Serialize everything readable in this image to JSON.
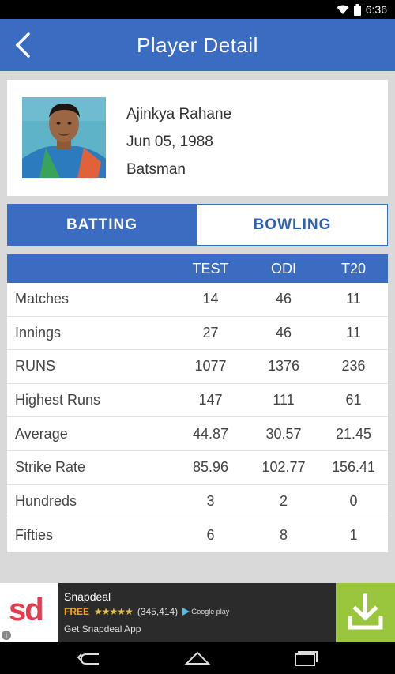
{
  "status_bar": {
    "time": "6:36"
  },
  "header": {
    "title": "Player Detail"
  },
  "player": {
    "name": "Ajinkya  Rahane",
    "dob": "Jun 05, 1988",
    "role": "Batsman"
  },
  "tabs": [
    {
      "label": "BATTING",
      "active": true
    },
    {
      "label": "BOWLING",
      "active": false
    }
  ],
  "stats": {
    "columns": [
      "TEST",
      "ODI",
      "T20"
    ],
    "rows": [
      {
        "label": "Matches",
        "values": [
          "14",
          "46",
          "11"
        ]
      },
      {
        "label": "Innings",
        "values": [
          "27",
          "46",
          "11"
        ]
      },
      {
        "label": "RUNS",
        "values": [
          "1077",
          "1376",
          "236"
        ]
      },
      {
        "label": "Highest Runs",
        "values": [
          "147",
          "111",
          "61"
        ]
      },
      {
        "label": "Average",
        "values": [
          "44.87",
          "30.57",
          "21.45"
        ]
      },
      {
        "label": "Strike Rate",
        "values": [
          "85.96",
          "102.77",
          "156.41"
        ]
      },
      {
        "label": "Hundreds",
        "values": [
          "3",
          "2",
          "0"
        ]
      },
      {
        "label": "Fifties",
        "values": [
          "6",
          "8",
          "1"
        ]
      }
    ]
  },
  "ad": {
    "logo_text": "sd",
    "app_name": "Snapdeal",
    "price": "FREE",
    "stars": "★★★★★",
    "rating": 4,
    "reviews": "(345,414)",
    "store": "Google play",
    "cta": "Get Snapdeal App",
    "info": "i"
  },
  "colors": {
    "primary": "#3a6cc1",
    "ad_download": "#9ac63d",
    "logo_red": "#e43c4f"
  }
}
